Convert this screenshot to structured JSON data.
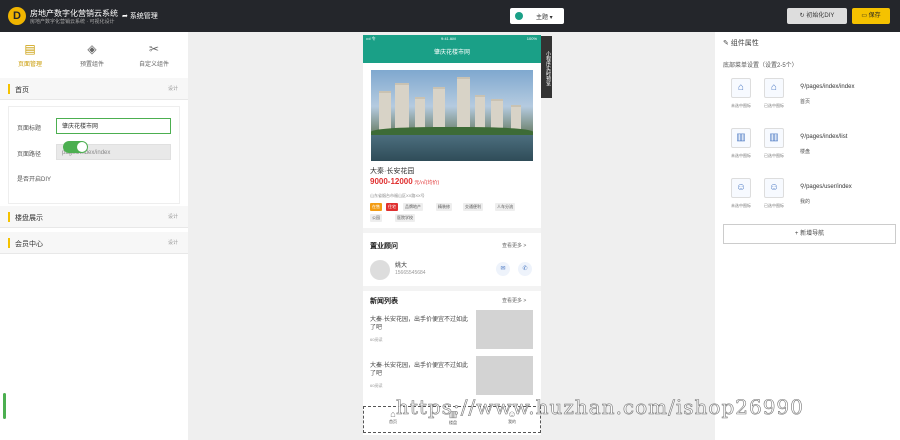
{
  "app": {
    "logo_letter": "D",
    "title": "房地产数字化营销云系统",
    "subtitle": "房地产数字化营销云系统 · 可视化设计",
    "back_label": "系统管理"
  },
  "toolbar": {
    "theme_label": "主题",
    "reset_label": "初始化DIY",
    "save_label": "保存"
  },
  "left_tabs": [
    {
      "label": "页面管理",
      "icon": "file-icon"
    },
    {
      "label": "预置组件",
      "icon": "cube-icon"
    },
    {
      "label": "自定义组件",
      "icon": "wrench-icon"
    }
  ],
  "sections": [
    {
      "name": "首页",
      "action": "设计"
    },
    {
      "name": "楼盘展示",
      "action": "设计"
    },
    {
      "name": "会员中心",
      "action": "设计"
    }
  ],
  "form": {
    "page_title_label": "页面标题",
    "page_title_value": "肇庆花楼市网",
    "page_path_label": "页面路径",
    "page_path_value": "pages/index/index",
    "diy_label": "是否开启DIY",
    "diy_enabled": true
  },
  "phone": {
    "status_signal": "•ııl 令",
    "status_time": "9:41 AM",
    "status_battery": "100%",
    "header_title": "肇庆花楼市网",
    "side_tag": "小程序实时预览",
    "property_name": "大秦·长安花园",
    "price": "9000-12000",
    "price_unit": "元/㎡(均价)",
    "address": "山东省烟台市福山区XX路XX号",
    "tags": [
      "在售",
      "住宅",
      "品牌地产",
      "精装修",
      "交通便利",
      "人车分流",
      "公园",
      "医院学校"
    ],
    "consultant_section": "置业顾问",
    "consultant_more": "查看更多 >",
    "consultant_name": "姚大",
    "consultant_phone": "15665545684",
    "news_section": "新闻列表",
    "news_more": "查看更多 >",
    "news": [
      {
        "title": "大秦·长安花园，出手价便宜不过如此了吧",
        "meta": "60阅读"
      },
      {
        "title": "大秦·长安花园，出手价便宜不过如此了吧",
        "meta": "60阅读"
      }
    ],
    "tabbar": [
      {
        "label": "首页",
        "icon": "home-icon"
      },
      {
        "label": "楼盘",
        "icon": "building-icon"
      },
      {
        "label": "我的",
        "icon": "user-icon"
      }
    ]
  },
  "right": {
    "title": "组件属性",
    "subtitle": "底部菜单设置（设置2-5个）",
    "nav_items": [
      {
        "icon": "home-icon",
        "glyph": "⌂",
        "cap_default": "未选中图标",
        "cap_active": "已选中图标",
        "path": "/pages/index/index",
        "name": "首页"
      },
      {
        "icon": "building-icon",
        "glyph": "▥",
        "cap_default": "未选中图标",
        "cap_active": "已选中图标",
        "path": "/pages/index/list",
        "name": "楼盘"
      },
      {
        "icon": "user-icon",
        "glyph": "☺",
        "cap_default": "未选中图标",
        "cap_active": "已选中图标",
        "path": "/pages/user/index",
        "name": "我的"
      }
    ],
    "add_label": "+ 新增导航"
  },
  "watermark": "https://www.huzhan.com/ishop26990",
  "colors": {
    "accent": "#f5c200",
    "brand_green": "#1aa087",
    "topbar": "#24262b",
    "price_red": "#e03030"
  }
}
